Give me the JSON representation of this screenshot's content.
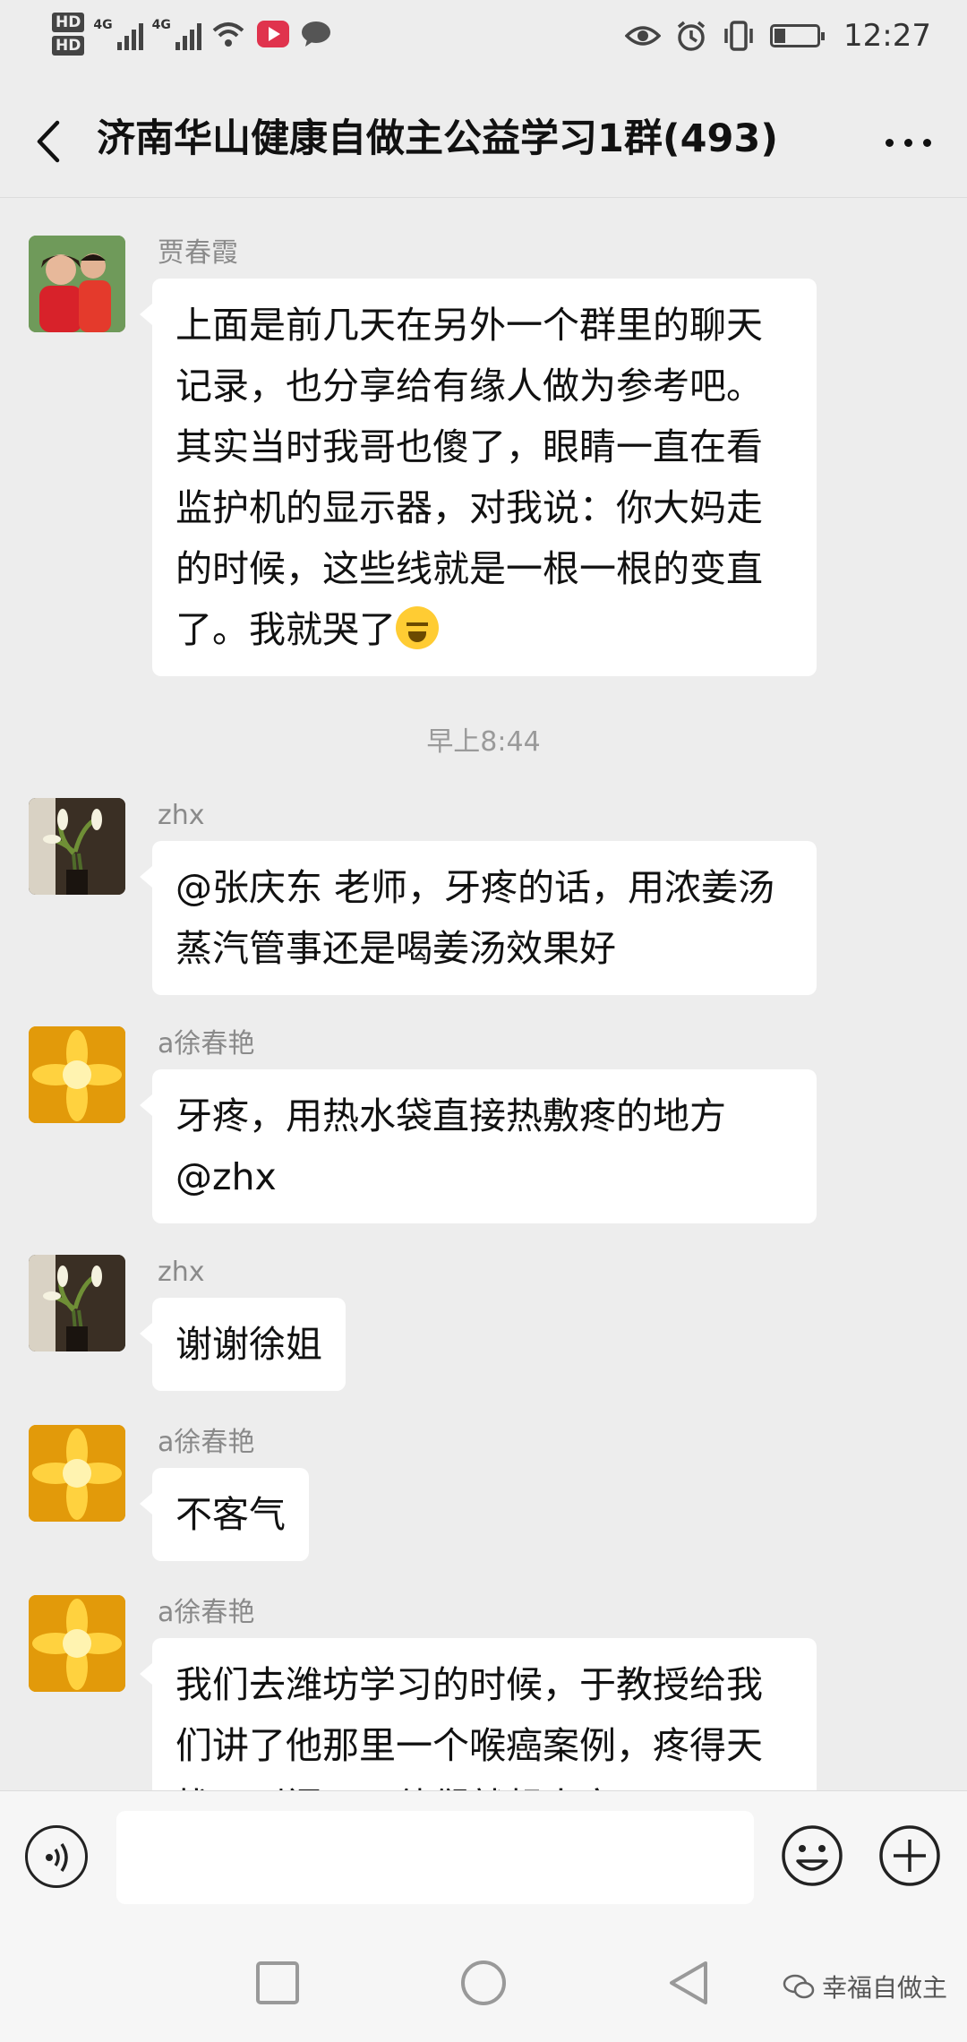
{
  "status_bar": {
    "hd1": "HD",
    "hd2": "HD",
    "net1": "4G",
    "net2": "4G",
    "time": "12:27"
  },
  "header": {
    "title": "济南华山健康自做主公益学习1群(493)"
  },
  "messages": [
    {
      "sender": "贾春霞",
      "text": "上面是前几天在另外一个群里的聊天记录，也分享给有缘人做为参考吧。其实当时我哥也傻了，眼睛一直在看监护机的显示器，对我说：你大妈走的时候，这些线就是一根一根的变直了。我就哭了",
      "emoji": "crying-face"
    },
    {
      "timestamp": "早上8:44"
    },
    {
      "sender": "zhx",
      "text": "@张庆东  老师，牙疼的话，用浓姜汤蒸汽管事还是喝姜汤效果好"
    },
    {
      "sender": "a徐春艳",
      "text": "牙疼，用热水袋直接热敷疼的地方 @zhx"
    },
    {
      "sender": "zhx",
      "text": "谢谢徐姐"
    },
    {
      "sender": "a徐春艳",
      "text": "不客气"
    },
    {
      "sender": "a徐春艳",
      "text": "我们去潍坊学习的时候，于教授给我们讲了他那里一个喉癌案例，疼得天找不到门了，他们就想人家"
    }
  ],
  "input": {
    "placeholder": ""
  },
  "watermark": "幸福自做主"
}
